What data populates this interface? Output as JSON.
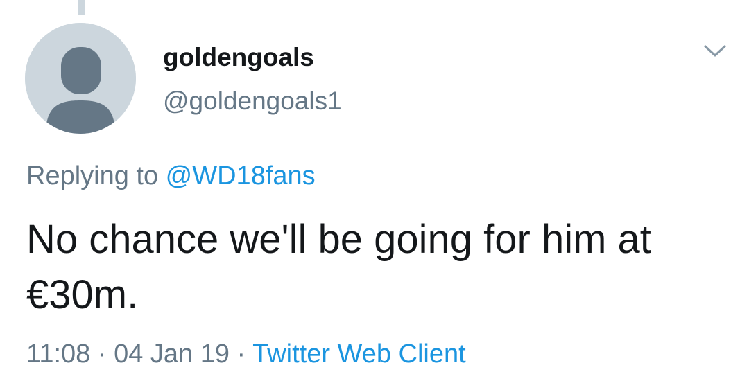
{
  "tweet": {
    "author": {
      "display_name": "goldengoals",
      "handle": "@goldengoals1",
      "avatar_icon": "default-profile-icon"
    },
    "reply_prefix": "Replying to ",
    "reply_to": "@WD18fans",
    "text": "No chance we'll be going for him at €30m.",
    "time": "11:08",
    "separator": " · ",
    "date": "04 Jan 19",
    "client": "Twitter Web Client",
    "menu_icon": "chevron-down-icon"
  },
  "colors": {
    "text": "#14171a",
    "secondary": "#657786",
    "link": "#1b95e0",
    "avatar_bg": "#ccd6dd",
    "avatar_fg": "#657786"
  }
}
